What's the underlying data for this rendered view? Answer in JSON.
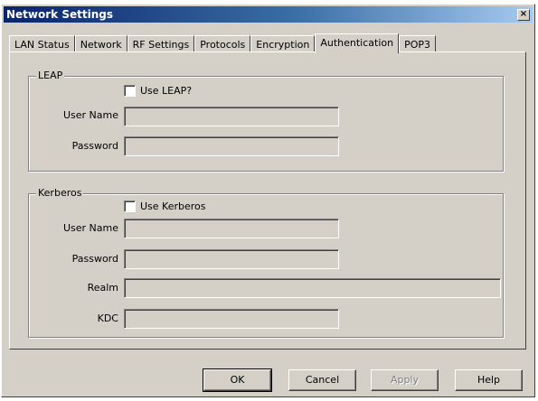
{
  "window": {
    "title": "Network Settings",
    "close_label": "×"
  },
  "tabs": [
    {
      "label": "LAN Status",
      "active": false
    },
    {
      "label": "Network",
      "active": false
    },
    {
      "label": "RF Settings",
      "active": false
    },
    {
      "label": "Protocols",
      "active": false
    },
    {
      "label": "Encryption",
      "active": false
    },
    {
      "label": "Authentication",
      "active": true
    },
    {
      "label": "POP3",
      "active": false
    }
  ],
  "leap": {
    "legend": "LEAP",
    "use_label": "Use LEAP?",
    "use_checked": false,
    "username_label": "User Name",
    "username_value": "",
    "password_label": "Password",
    "password_value": ""
  },
  "kerberos": {
    "legend": "Kerberos",
    "use_label": "Use Kerberos",
    "use_checked": false,
    "username_label": "User Name",
    "username_value": "",
    "password_label": "Password",
    "password_value": "",
    "realm_label": "Realm",
    "realm_value": "",
    "kdc_label": "KDC",
    "kdc_value": ""
  },
  "buttons": {
    "ok": "OK",
    "cancel": "Cancel",
    "apply": "Apply",
    "help": "Help"
  }
}
